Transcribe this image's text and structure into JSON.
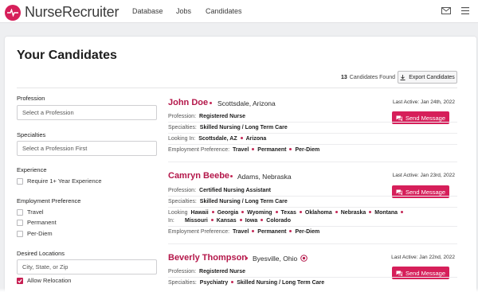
{
  "brand": {
    "name": "NurseRecruiter",
    "color": "#d61f5a"
  },
  "nav": {
    "database": "Database",
    "jobs": "Jobs",
    "candidates": "Candidates",
    "mail_icon": "mail-icon",
    "menu_icon": "hamburger-icon"
  },
  "page": {
    "title": "Your Candidates",
    "count": "13",
    "count_label": "Candidates Found",
    "export_label": "Export Candidates"
  },
  "filters": {
    "profession_label": "Profession",
    "profession_placeholder": "Select a Profession",
    "specialties_label": "Specialties",
    "specialties_placeholder": "Select a Profession First",
    "experience_label": "Experience",
    "experience_option": "Require 1+ Year Experience",
    "experience_checked": false,
    "employment_label": "Employment Preference",
    "employment_options": [
      "Travel",
      "Permanent",
      "Per-Diem"
    ],
    "locations_label": "Desired Locations",
    "locations_placeholder": "City, State, or Zip",
    "relocation_label": "Allow Relocation",
    "relocation_checked": true
  },
  "labels": {
    "profession": "Profession:",
    "specialties": "Specialties:",
    "looking_in": "Looking In:",
    "looking_1": "Looking",
    "looking_2": "In:",
    "employment": "Employment Preference:",
    "send_message": "Send Message"
  },
  "candidates": [
    {
      "name": "John Doe",
      "location": "Scottsdale, Arizona",
      "last_active": "Last Active: Jan 24th, 2022",
      "profession": "Registered Nurse",
      "specialties": "Skilled Nursing / Long Term Care",
      "looking_in": [
        "Scottsdale, AZ",
        "Arizona"
      ],
      "employment": [
        "Travel",
        "Permanent",
        "Per-Diem"
      ]
    },
    {
      "name": "Camryn Beebe",
      "location": "Adams, Nebraska",
      "last_active": "Last Active: Jan 23rd, 2022",
      "profession": "Certified Nursing Assistant",
      "specialties": "Skilled Nursing / Long Term Care",
      "looking_in_line1": [
        "Hawaii",
        "Georgia",
        "Wyoming",
        "Texas",
        "Oklahoma",
        "Nebraska",
        "Montana"
      ],
      "looking_in_line2": [
        "Missouri",
        "Kansas",
        "Iowa",
        "Colorado"
      ],
      "employment": [
        "Travel",
        "Permanent",
        "Per-Diem"
      ]
    },
    {
      "name": "Beverly Thompson",
      "location": "Byesville, Ohio",
      "last_active": "Last Active: Jan 22nd, 2022",
      "profession": "Registered Nurse",
      "specialties": [
        "Psychiatry",
        "Skilled Nursing / Long Term Care"
      ]
    }
  ]
}
